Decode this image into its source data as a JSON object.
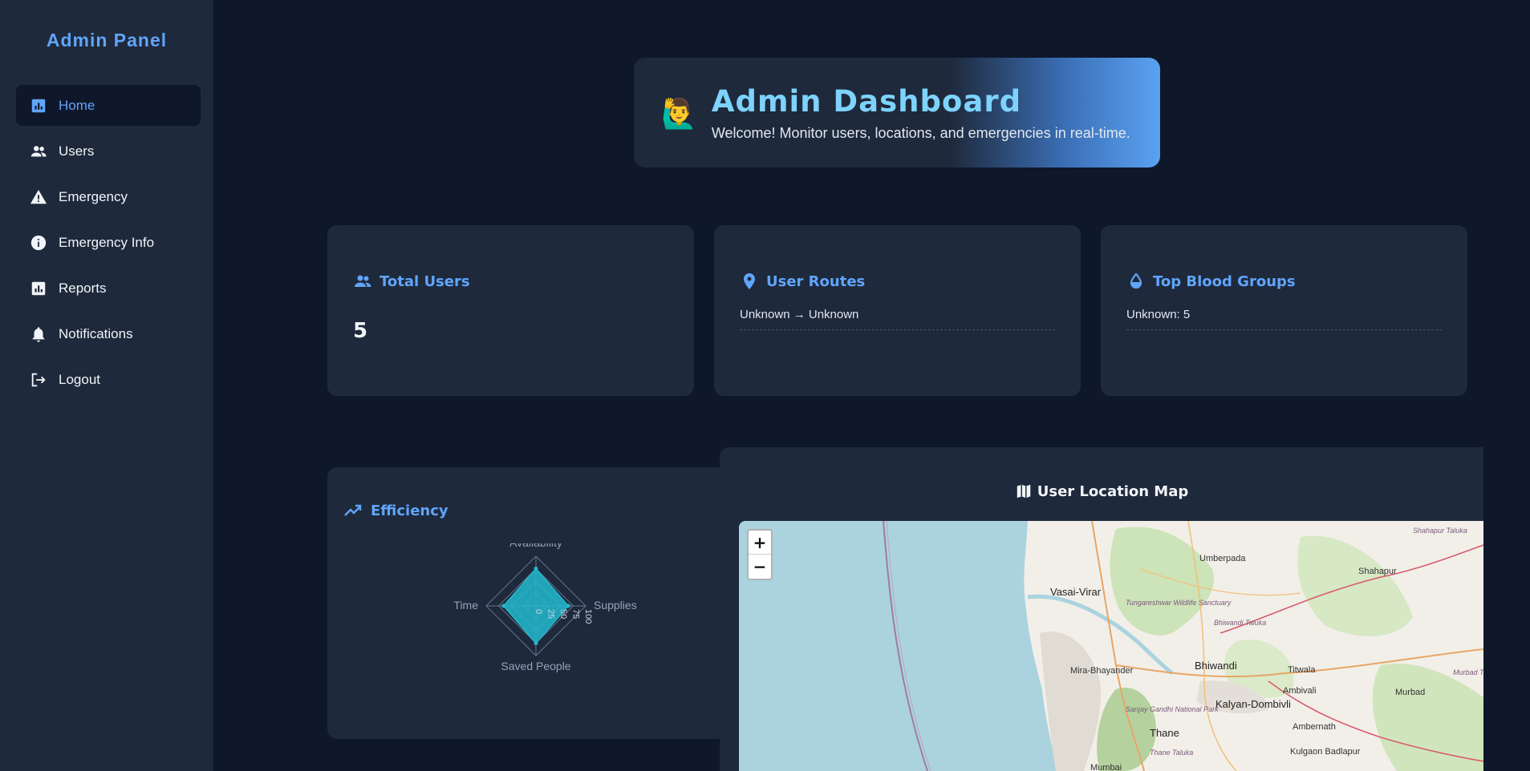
{
  "sidebar": {
    "brand": "Admin Panel",
    "items": [
      {
        "label": "Home",
        "icon": "bar-chart-icon",
        "active": true
      },
      {
        "label": "Users",
        "icon": "users-icon"
      },
      {
        "label": "Emergency",
        "icon": "warning-icon"
      },
      {
        "label": "Emergency Info",
        "icon": "info-icon"
      },
      {
        "label": "Reports",
        "icon": "report-icon"
      },
      {
        "label": "Notifications",
        "icon": "bell-icon"
      },
      {
        "label": "Logout",
        "icon": "logout-icon"
      }
    ]
  },
  "header": {
    "emoji": "🙋‍♂️",
    "title": "Admin Dashboard",
    "subtitle": "Welcome! Monitor users, locations, and emergencies in real-time."
  },
  "cards": {
    "total_users": {
      "title": "Total Users",
      "value": "5",
      "icon": "users-icon"
    },
    "user_routes": {
      "title": "User Routes",
      "routes": [
        "Unknown → Unknown"
      ],
      "icon": "location-pin-icon"
    },
    "blood_groups": {
      "title": "Top Blood Groups",
      "items": [
        "Unknown: 5"
      ],
      "icon": "drop-icon"
    }
  },
  "efficiency": {
    "title": "Efficiency",
    "icon": "trend-icon"
  },
  "chart_data": {
    "type": "radar",
    "title": "Efficiency",
    "axes": [
      "Availability",
      "Supplies",
      "Saved People",
      "Time"
    ],
    "tick_labels": [
      "0",
      "25",
      "50",
      "75",
      "100"
    ],
    "range": [
      0,
      100
    ],
    "series": [
      {
        "values": [
          75,
          65,
          75,
          65
        ],
        "color": "#22b8cf"
      }
    ]
  },
  "map": {
    "title": "User Location Map",
    "icon": "map-icon",
    "zoom_in": "+",
    "zoom_out": "−",
    "places": [
      "Vasai-Virar",
      "Mira-Bhayander",
      "Thane",
      "Mumbai",
      "Bhiwandi",
      "Kalyan-Dombivli",
      "Kulgaon Badlapur",
      "Umberpada",
      "Shahapur",
      "Titwala",
      "Ambivali",
      "Murbad",
      "Ambernath",
      "Tungareshwar Wildlife Sanctuary",
      "Sanjay Gandhi National Park",
      "Bhiwandi Taluka",
      "Thane Taluka",
      "Shahapur Taluka",
      "Murbad Taluka"
    ]
  },
  "colors": {
    "background": "#0f172a",
    "panel": "#1e293b",
    "accent": "#60a5fa",
    "radar_fill": "#22b8cf"
  }
}
